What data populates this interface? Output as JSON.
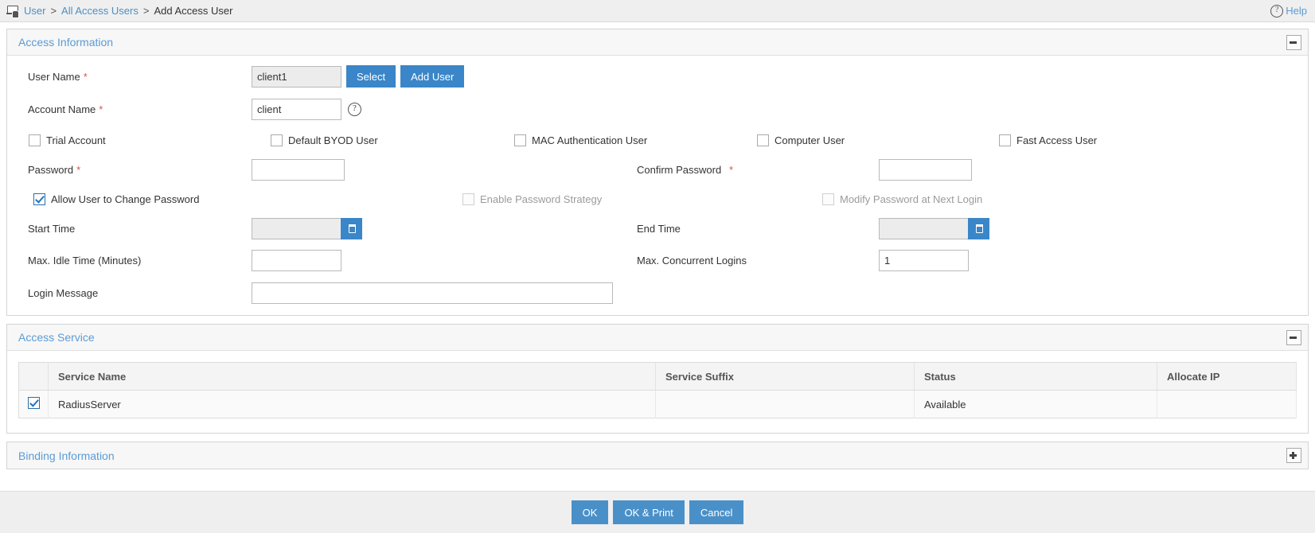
{
  "breadcrumb": {
    "icon": "user-screen-icon",
    "root": "User",
    "sep1": ">",
    "middle": "All Access Users",
    "sep2": ">",
    "current": "Add Access User"
  },
  "help": {
    "icon": "question-circle-icon",
    "label": "Help"
  },
  "access_information": {
    "title": "Access Information",
    "collapse_icon": "minus-icon",
    "user_name": {
      "label": "User Name",
      "required": "*",
      "value": "client1",
      "select_button": "Select",
      "add_user_button": "Add User"
    },
    "account_name": {
      "label": "Account Name",
      "required": "*",
      "value": "client",
      "help_icon": "question-circle-icon"
    },
    "user_type_checkboxes": [
      {
        "label": "Trial Account",
        "checked": false
      },
      {
        "label": "Default BYOD User",
        "checked": false
      },
      {
        "label": "MAC Authentication User",
        "checked": false
      },
      {
        "label": "Computer User",
        "checked": false
      },
      {
        "label": "Fast Access User",
        "checked": false
      }
    ],
    "password": {
      "label": "Password",
      "required": "*",
      "value": ""
    },
    "confirm_password": {
      "label": "Confirm Password",
      "required": "*",
      "value": ""
    },
    "password_checkboxes": [
      {
        "label": "Allow User to Change Password",
        "checked": true,
        "disabled": false
      },
      {
        "label": "Enable Password Strategy",
        "checked": false,
        "disabled": true
      },
      {
        "label": "Modify Password at Next Login",
        "checked": false,
        "disabled": true
      }
    ],
    "start_time": {
      "label": "Start Time",
      "value": "",
      "calendar_icon": "calendar-icon"
    },
    "end_time": {
      "label": "End Time",
      "value": "",
      "calendar_icon": "calendar-icon"
    },
    "max_idle_time": {
      "label": "Max. Idle Time (Minutes)",
      "value": ""
    },
    "max_concurrent_logins": {
      "label": "Max. Concurrent Logins",
      "value": "1"
    },
    "login_message": {
      "label": "Login Message",
      "value": ""
    }
  },
  "access_service": {
    "title": "Access Service",
    "collapse_icon": "minus-icon",
    "columns": [
      "",
      "Service Name",
      "Service Suffix",
      "Status",
      "Allocate IP"
    ],
    "rows": [
      {
        "selected": true,
        "service_name": "RadiusServer",
        "service_suffix": "",
        "status": "Available",
        "allocate_ip": ""
      }
    ]
  },
  "binding_information": {
    "title": "Binding Information",
    "expand_icon": "plus-icon"
  },
  "footer": {
    "ok": "OK",
    "ok_and_print": "OK & Print",
    "cancel": "Cancel"
  },
  "colors": {
    "accent_blue": "#3a86c8",
    "link_blue": "#5b9bd5",
    "required_red": "#d9534f"
  }
}
